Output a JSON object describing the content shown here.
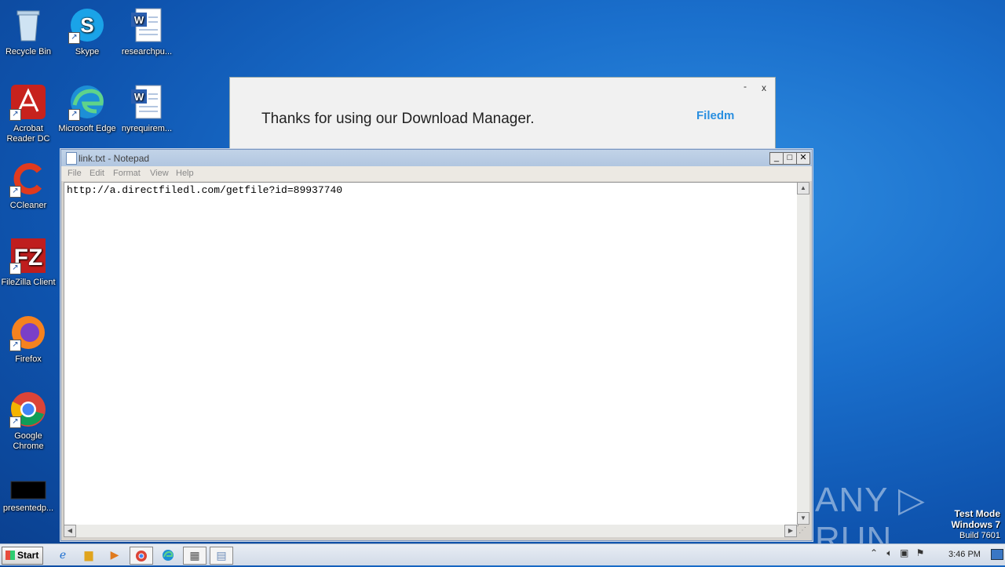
{
  "desktop": {
    "icons": [
      {
        "label": "Recycle Bin",
        "icon": "recycle-bin-icon"
      },
      {
        "label": "Skype",
        "icon": "skype-icon"
      },
      {
        "label": "researchpu...",
        "icon": "word-doc-icon"
      },
      {
        "label": "Acrobat Reader DC",
        "icon": "acrobat-icon"
      },
      {
        "label": "Microsoft Edge",
        "icon": "edge-icon"
      },
      {
        "label": "nyrequirem...",
        "icon": "word-doc-icon"
      },
      {
        "label": "CCleaner",
        "icon": "ccleaner-icon"
      },
      {
        "label": "FileZilla Client",
        "icon": "filezilla-icon"
      },
      {
        "label": "Firefox",
        "icon": "firefox-icon"
      },
      {
        "label": "Google Chrome",
        "icon": "chrome-icon"
      },
      {
        "label": "presentedp...",
        "icon": "black-file-icon"
      }
    ]
  },
  "ad_window": {
    "message": "Thanks for using our Download Manager.",
    "brand": "Filedm",
    "minimize": "-",
    "close": "x"
  },
  "notepad": {
    "title": "link.txt - Notepad",
    "menu": [
      "File",
      "Edit",
      "Format",
      "View",
      "Help"
    ],
    "content": "http://a.directfiledl.com/getfile?id=89937740",
    "buttons": {
      "minimize": "_",
      "maximize": "□",
      "close": "✕"
    }
  },
  "watermark": {
    "logo": "ANY ▷ RUN",
    "line1": "Test Mode",
    "line2": "Windows 7",
    "line3": "Build 7601"
  },
  "taskbar": {
    "start_label": "Start",
    "clock": "3:46 PM",
    "apps": [
      "ie-icon",
      "explorer-icon",
      "media-player-icon",
      "chrome-icon",
      "edge-icon",
      "network-app-icon",
      "notepad-icon"
    ]
  }
}
